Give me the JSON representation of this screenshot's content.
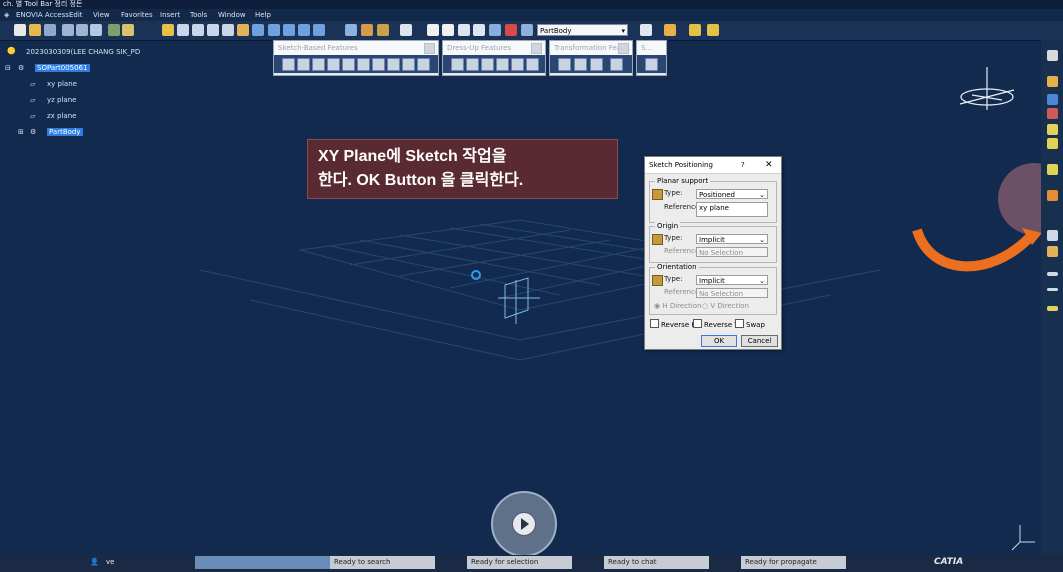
{
  "window": {
    "title": "ch. 별 Tool Bar 정리 정돈"
  },
  "menu": {
    "items": [
      "ENOVIA Access",
      "Edit",
      "View",
      "Favorites",
      "Insert",
      "Tools",
      "Window",
      "Help"
    ]
  },
  "toolbar": {
    "part_selector": "PartBody"
  },
  "floating_toolbars": [
    "Sketch-Based Features",
    "Dress-Up Features",
    "Transformation Feat...",
    "S..."
  ],
  "tree": {
    "root": "2023030309(LEE CHANG SIK_PD",
    "part": "SOPart005061",
    "planes": [
      "xy plane",
      "yz plane",
      "zx plane"
    ],
    "body": "PartBody"
  },
  "callout": {
    "line1": "XY Plane에 Sketch 작업을",
    "line2": "한다. OK Button 을 클릭한다."
  },
  "dialog": {
    "title": "Sketch Positioning",
    "help": "?",
    "close": "✕",
    "planar_support": {
      "label": "Planar support",
      "type_label": "Type:",
      "type_value": "Positioned",
      "reference_label": "Reference:",
      "reference_value": "xy plane"
    },
    "origin": {
      "label": "Origin",
      "type_label": "Type:",
      "type_value": "Implicit",
      "reference_label": "Reference:",
      "reference_value": "No Selection"
    },
    "orientation": {
      "label": "Orientation",
      "type_label": "Type:",
      "type_value": "Implicit",
      "reference_label": "Reference:",
      "reference_value": "No Selection",
      "h_direction": "H Direction",
      "v_direction": "V Direction"
    },
    "checks": [
      "Reverse H",
      "Reverse V",
      "Swap"
    ],
    "ok": "OK",
    "cancel": "Cancel"
  },
  "status": {
    "search": "Ready to search",
    "selection": "Ready for selection",
    "chat": "Ready to chat",
    "propagate": "Ready for propagate",
    "brand": "CATIA",
    "user": "ve"
  },
  "colors": {
    "viewport": "#112a4e",
    "callout": "#5a2a33",
    "arrow": "#ec6f1f",
    "highlight": "#2f7ce0"
  }
}
